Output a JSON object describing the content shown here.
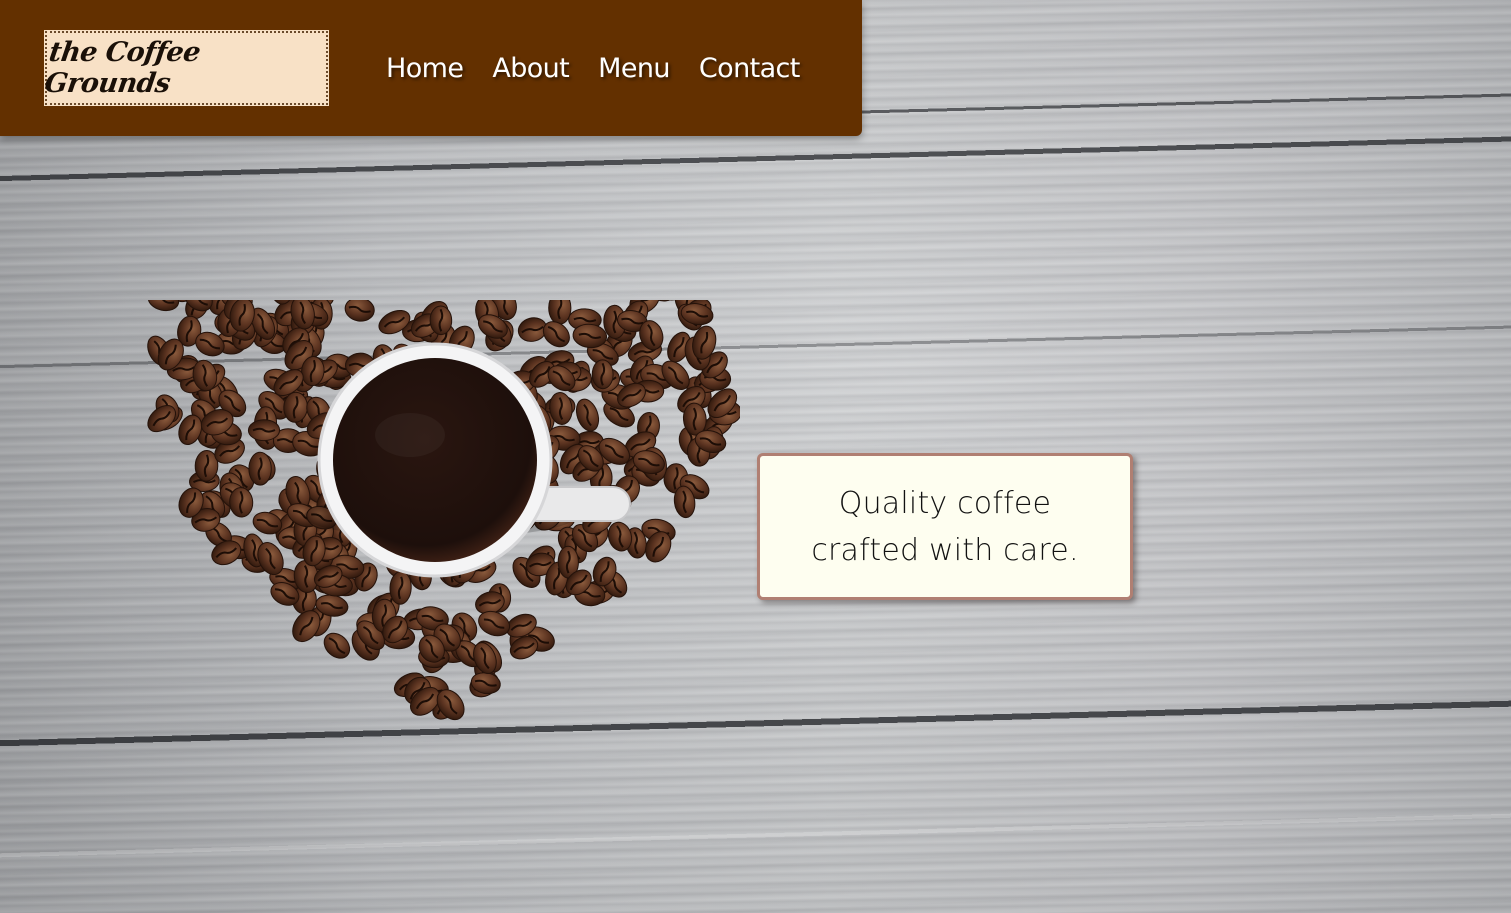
{
  "header": {
    "logo_text": "the Coffee Grounds",
    "nav": [
      {
        "label": "Home"
      },
      {
        "label": "About"
      },
      {
        "label": "Menu"
      },
      {
        "label": "Contact"
      }
    ]
  },
  "hero": {
    "tagline_line1": "Quality coffee",
    "tagline_line2": "crafted with care."
  },
  "colors": {
    "header_bg": "#633000",
    "logo_bg": "#f8e1c6",
    "card_bg": "#fefef0",
    "card_border": "#b07f72"
  }
}
